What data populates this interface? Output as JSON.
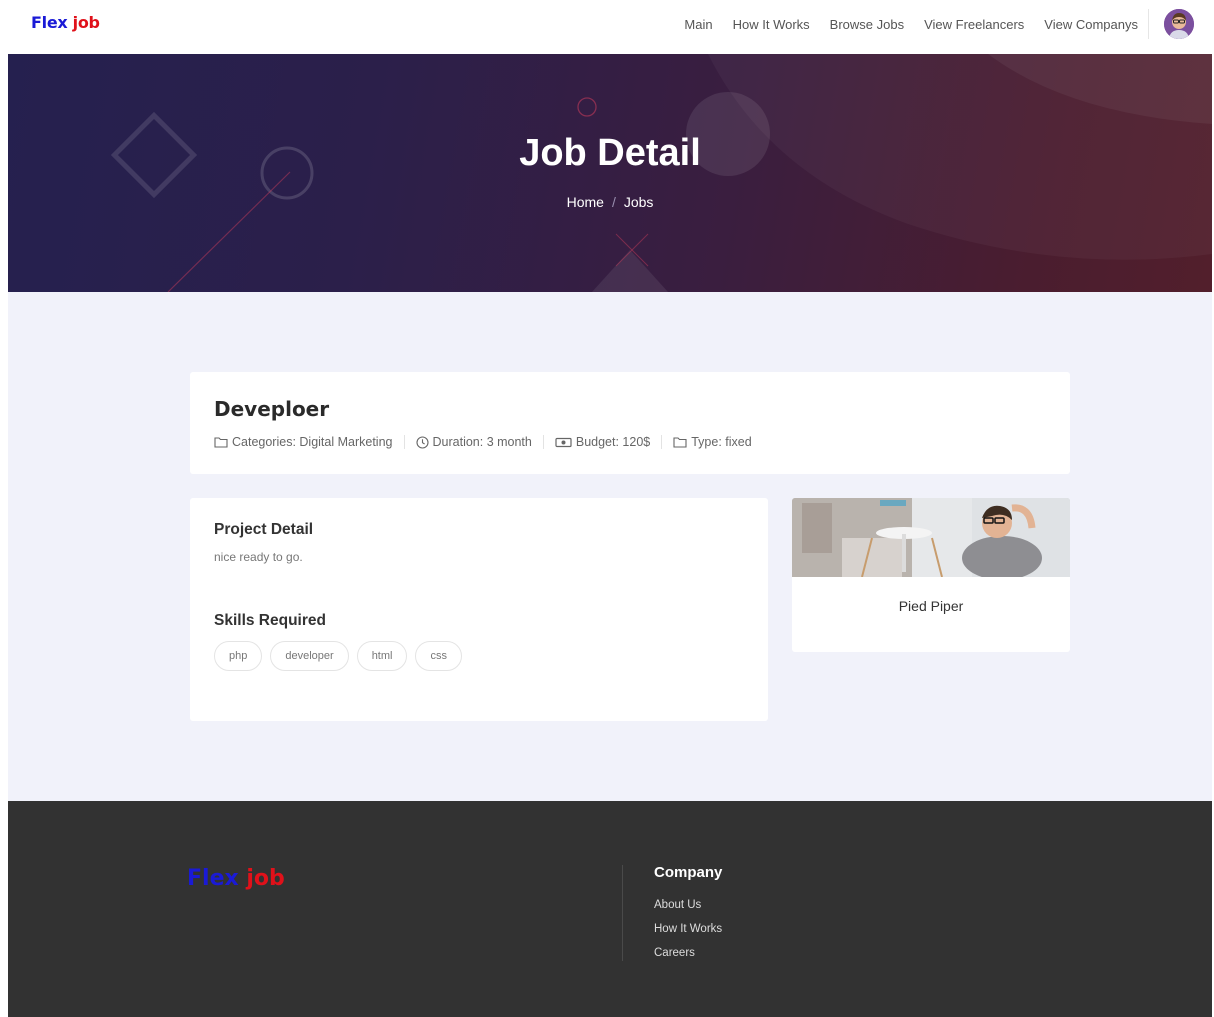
{
  "brand": {
    "part1": "Flex",
    "part2": "job",
    "color1": "#1a1ad6",
    "color2": "#e0111a"
  },
  "nav": {
    "items": [
      "Main",
      "How It Works",
      "Browse Jobs",
      "View Freelancers",
      "View Companys"
    ],
    "avatar_icon": "user-avatar"
  },
  "hero": {
    "title": "Job Detail",
    "breadcrumb": {
      "home": "Home",
      "separator": "/",
      "current": "Jobs"
    }
  },
  "job": {
    "title": "Deveploer",
    "meta": {
      "category": "Categories: Digital Marketing",
      "duration": "Duration: 3 month",
      "budget": "Budget: 120$",
      "type": "Type: fixed"
    }
  },
  "detail": {
    "project_heading": "Project Detail",
    "project_text": "nice ready to go.",
    "skills_heading": "Skills Required",
    "skills": [
      "php",
      "developer",
      "html",
      "css"
    ]
  },
  "company": {
    "name": "Pied Piper"
  },
  "footer": {
    "company_heading": "Company",
    "links": [
      "About Us",
      "How It Works",
      "Careers"
    ]
  }
}
